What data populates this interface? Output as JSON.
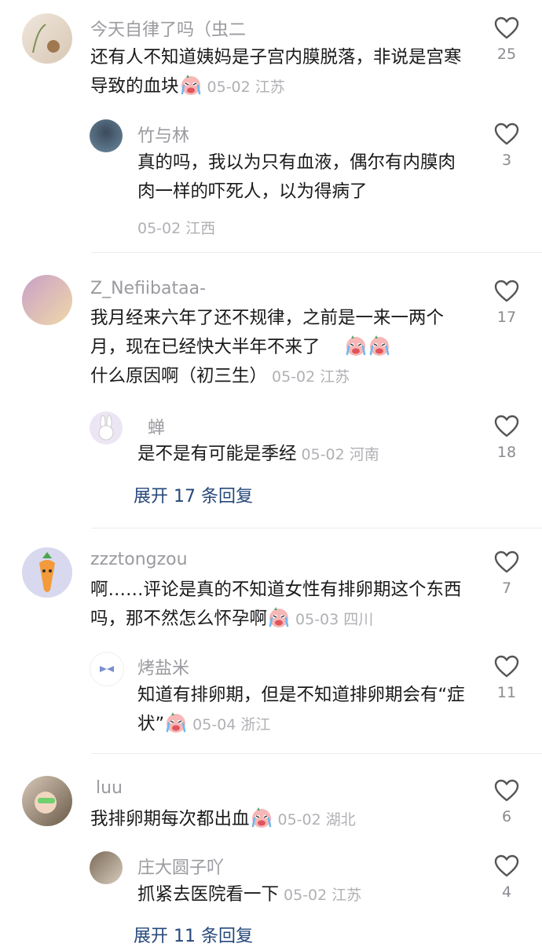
{
  "comments": [
    {
      "user": "今天自律了吗（虫二",
      "text": "还有人不知道姨妈是子宫内膜脱落，非说是宫寒导致的血块",
      "meta": "05-02 江苏",
      "likes": "25",
      "reply": {
        "user": "竹与林",
        "text": "真的吗，我以为只有血液，偶尔有内膜肉肉一样的吓死人，以为得病了",
        "meta": "05-02 江西",
        "likes": "3"
      }
    },
    {
      "user": "Z_Nefiibataa-",
      "text_1": "我月经来六年了还不规律，之前是一来一两个月，现在已经快大半年不来了",
      "text_2": "什么原因啊（初三生）",
      "meta": "05-02 江苏",
      "likes": "17",
      "reply": {
        "user": "蝉",
        "text": "是不是有可能是季经",
        "meta": "05-02 河南",
        "likes": "18"
      },
      "expand": "展开 17 条回复"
    },
    {
      "user": "zzztongzou",
      "text": "啊……评论是真的不知道女性有排卵期这个东西吗，那不然怎么怀孕啊",
      "meta": "05-03 四川",
      "likes": "7",
      "reply": {
        "user": "烤盐米",
        "text": "知道有排卵期，但是不知道排卵期会有“症状”",
        "meta": "05-04 浙江",
        "likes": "11"
      }
    },
    {
      "user": "luu",
      "text": "我排卵期每次都出血",
      "meta": "05-02 湖北",
      "likes": "6",
      "reply": {
        "user": "庄大圆子吖",
        "text": "抓紧去医院看一下",
        "meta": "05-02 江苏",
        "likes": "4"
      },
      "expand": "展开 11 条回复"
    }
  ],
  "colors": {
    "expand_link": "#26487a",
    "meta_gray": "#b0b0b5",
    "username_gray": "#9a9aa0"
  },
  "icons": [
    "heart-outline-icon",
    "crying-face-emoji"
  ]
}
